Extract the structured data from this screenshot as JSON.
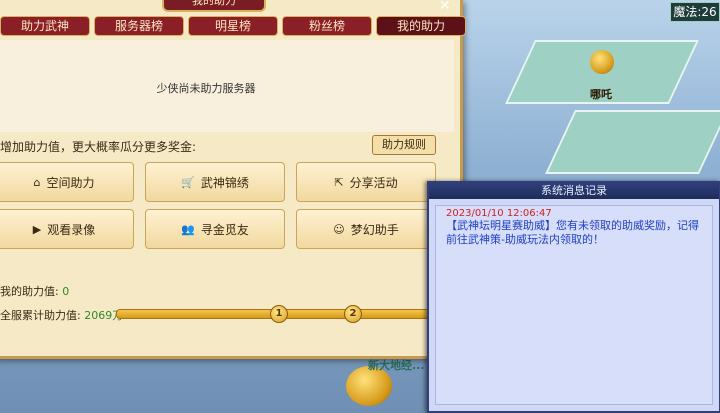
{
  "window_title": "我的助力",
  "close_icon": "close-icon",
  "tabs": [
    "助力武神",
    "服务器榜",
    "明星榜",
    "粉丝榜",
    "我的助力"
  ],
  "active_tab": 4,
  "status_text": "少侠尚未助力服务器",
  "hint_text": "增加助力值，更大概率瓜分更多奖金:",
  "rule_button": "助力规则",
  "actions": [
    {
      "label": "空间助力",
      "icon": "home-icon",
      "glyph": "⌂"
    },
    {
      "label": "武神锦绣",
      "icon": "cart-icon",
      "glyph": "🛒"
    },
    {
      "label": "分享活动",
      "icon": "share-icon",
      "glyph": "⇱"
    },
    {
      "label": "观看录像",
      "icon": "play-icon",
      "glyph": "▶"
    },
    {
      "label": "寻金觅友",
      "icon": "users-icon",
      "glyph": "👥"
    },
    {
      "label": "梦幻助手",
      "icon": "assistant-icon",
      "glyph": "☺"
    }
  ],
  "my_power_label": "我的助力值:",
  "my_power_value": "0",
  "server_total_label": "全服累计助力值:",
  "server_total_value": "2069万+",
  "progress_nodes": [
    "1",
    "2"
  ],
  "message_window": {
    "title": "系统消息记录",
    "timestamp": "2023/01/10 12:06:47",
    "text": "【武神坛明星赛助威】您有未领取的助威奖励，记得前往武神策-助威玩法内领取的！"
  },
  "mana_label": "魔法:26",
  "character_name": "哪吒",
  "map_label": "新大地经...",
  "colors": {
    "tab_bg": "#8a1f28",
    "panel_bg": "#f6e9c5",
    "accent_gold": "#d69a1a",
    "msg_red": "#d21f1f",
    "msg_blue": "#1f3fbf"
  }
}
